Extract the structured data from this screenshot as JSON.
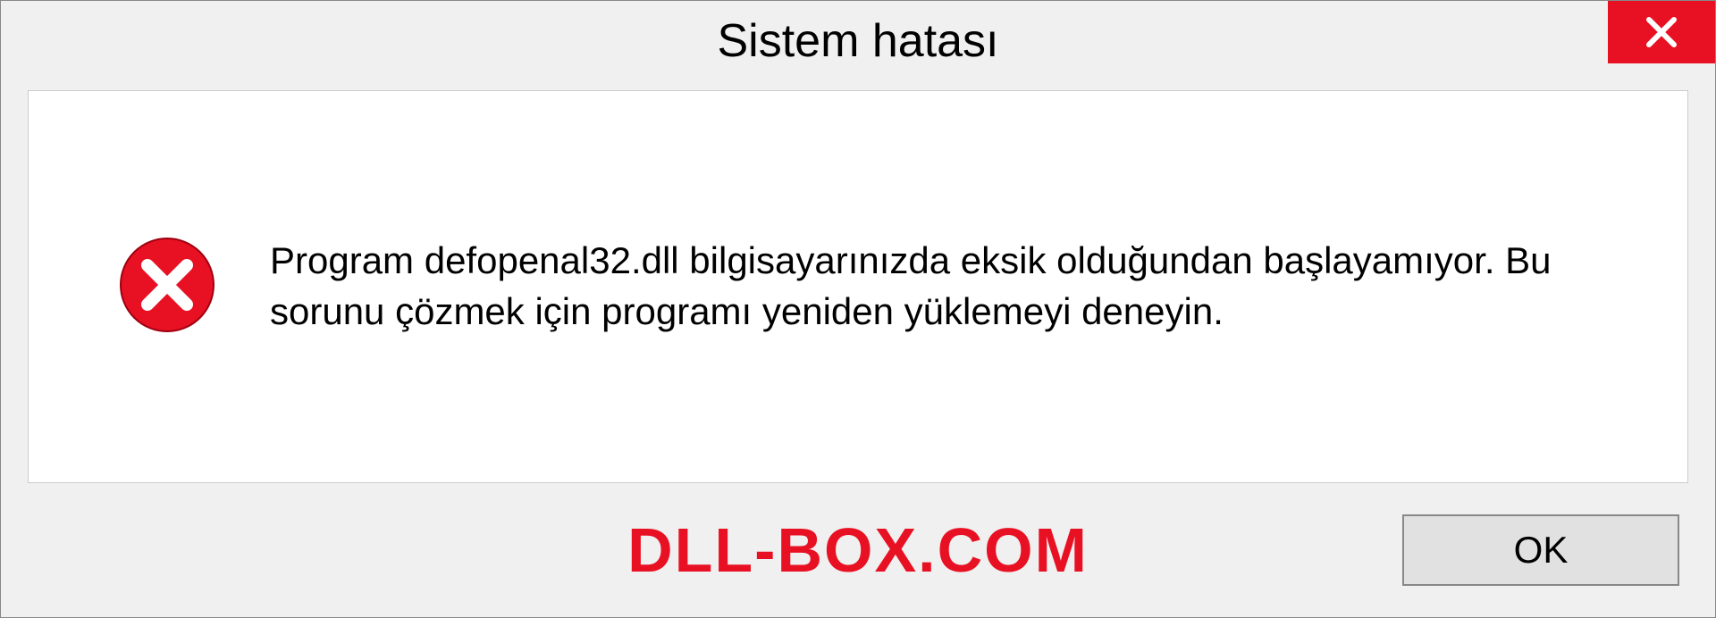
{
  "dialog": {
    "title": "Sistem hatası",
    "message": "Program defopenal32.dll bilgisayarınızda eksik olduğundan başlayamıyor. Bu sorunu çözmek için programı yeniden yüklemeyi deneyin.",
    "ok_label": "OK"
  },
  "watermark": "DLL-BOX.COM",
  "colors": {
    "close_bg": "#e81123",
    "watermark": "#e81123"
  }
}
